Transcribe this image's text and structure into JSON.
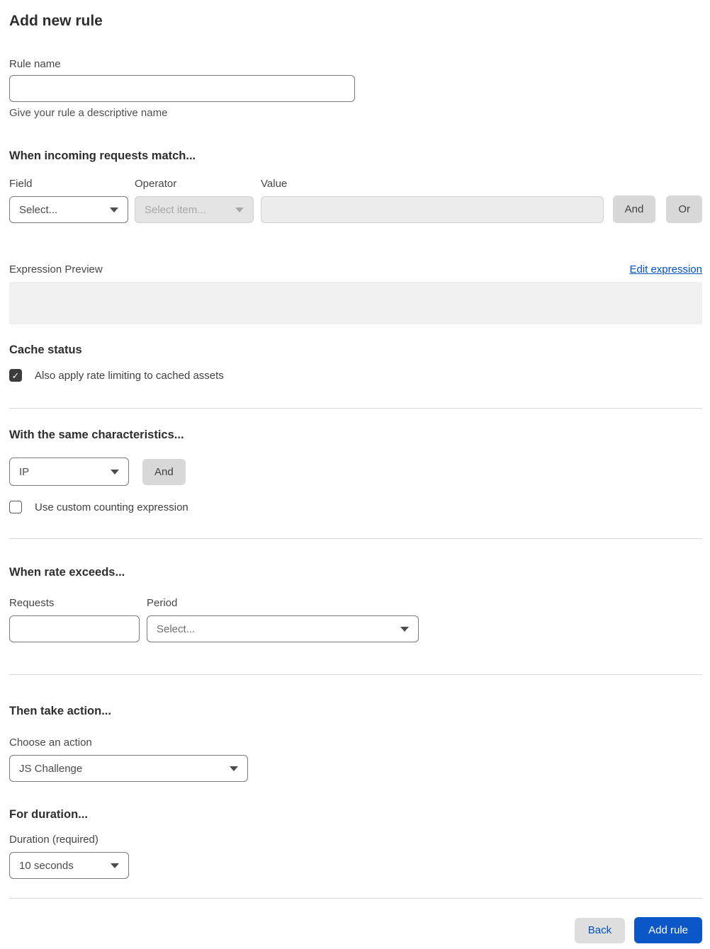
{
  "page": {
    "title": "Add new rule"
  },
  "rule_name": {
    "label": "Rule name",
    "value": "",
    "help": "Give your rule a descriptive name"
  },
  "match_section": {
    "heading": "When incoming requests match...",
    "field": {
      "label": "Field",
      "selected": "Select..."
    },
    "operator": {
      "label": "Operator",
      "selected": "Select item...",
      "disabled": true
    },
    "value": {
      "label": "Value",
      "value": "",
      "disabled": true
    },
    "and_label": "And",
    "or_label": "Or",
    "expression_preview_label": "Expression Preview",
    "edit_expression_label": "Edit expression",
    "expression_value": ""
  },
  "cache_status": {
    "heading": "Cache status",
    "checkbox_label": "Also apply rate limiting to cached assets",
    "checked": true
  },
  "characteristics": {
    "heading": "With the same characteristics...",
    "selected": "IP",
    "and_label": "And",
    "checkbox_label": "Use custom counting expression",
    "checked": false
  },
  "rate": {
    "heading": "When rate exceeds...",
    "requests": {
      "label": "Requests",
      "value": ""
    },
    "period": {
      "label": "Period",
      "selected": "Select..."
    }
  },
  "action": {
    "heading": "Then take action...",
    "choose_label": "Choose an action",
    "selected": "JS Challenge"
  },
  "duration": {
    "heading": "For duration...",
    "label": "Duration (required)",
    "selected": "10 seconds"
  },
  "footer": {
    "back_label": "Back",
    "add_rule_label": "Add rule"
  },
  "icons": {
    "checkmark": "✓",
    "chevron_down": "▾"
  },
  "colors": {
    "primary_button_blue": "#0b57c8",
    "link_blue": "#0051c3",
    "disabled_fill": "#e4e4e4",
    "preview_box_fill": "#f0f0f0",
    "checkbox_checked_fill": "#3c3c3c"
  }
}
